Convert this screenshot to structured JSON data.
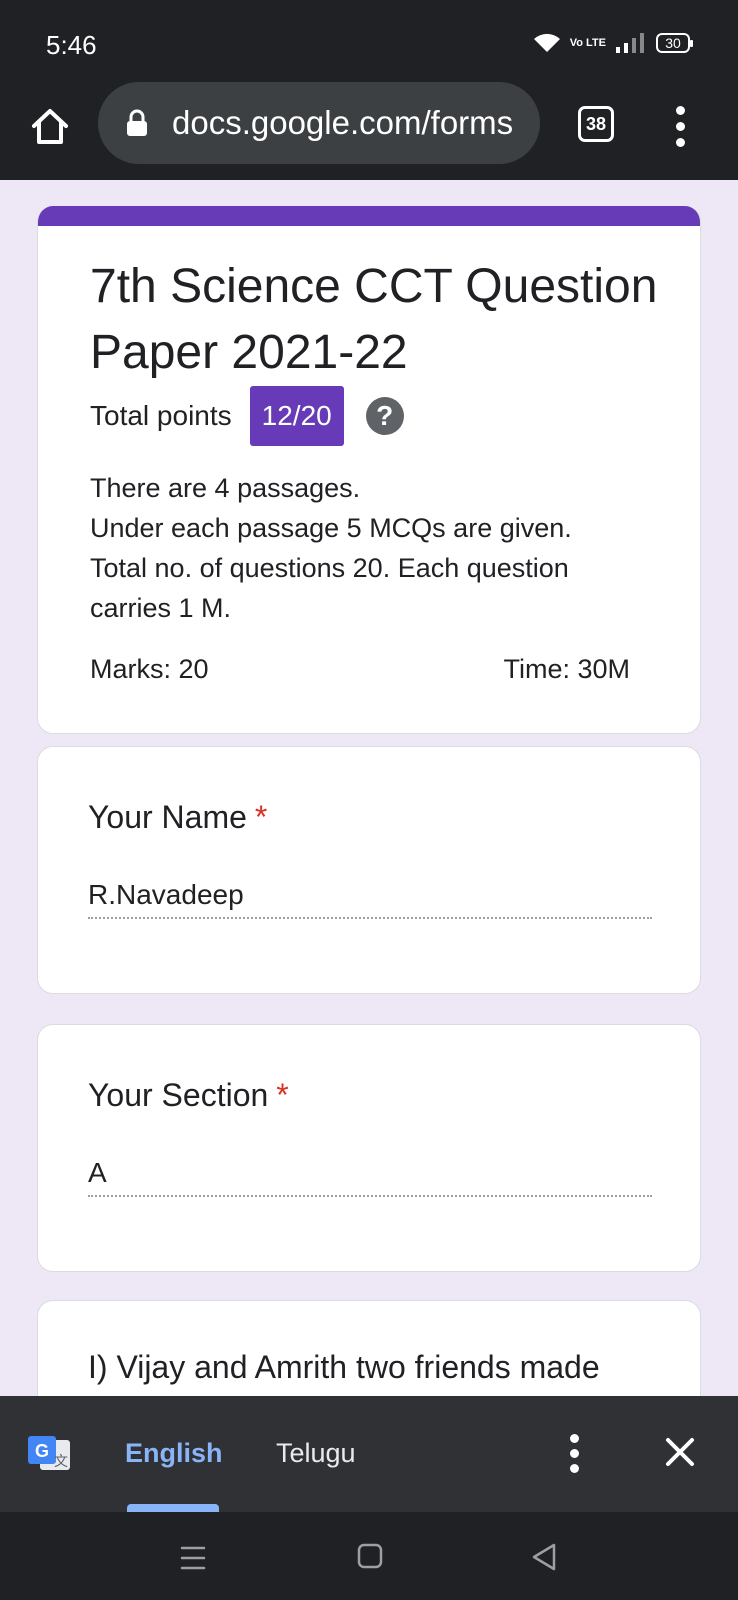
{
  "status_bar": {
    "time": "5:46",
    "network_label": "Vo LTE",
    "battery": "30"
  },
  "browser": {
    "url": "docs.google.com/forms",
    "tab_count": "38"
  },
  "form": {
    "title": "7th Science CCT Question Paper 2021-22",
    "points_label": "Total points",
    "points_value": "12/20",
    "help_glyph": "?",
    "description": [
      "There are 4 passages.",
      "Under  each passage 5 MCQs are given.",
      "Total no. of questions 20.  Each question",
      "carries 1 M."
    ],
    "marks": "Marks: 20",
    "time": "Time: 30M",
    "accent_color": "#673ab7",
    "questions": [
      {
        "title": "Your Name",
        "required_mark": "*",
        "answer": "R.Navadeep"
      },
      {
        "title": "Your Section",
        "required_mark": "*",
        "answer": "A"
      }
    ],
    "partial_question": "I) Vijay and Amrith two friends made"
  },
  "translate_bar": {
    "languages": [
      "English",
      "Telugu"
    ],
    "selected": "English",
    "icon": "google-translate-icon"
  },
  "nav_bar": {
    "icons": [
      "recents-icon",
      "home-icon",
      "back-icon"
    ]
  }
}
